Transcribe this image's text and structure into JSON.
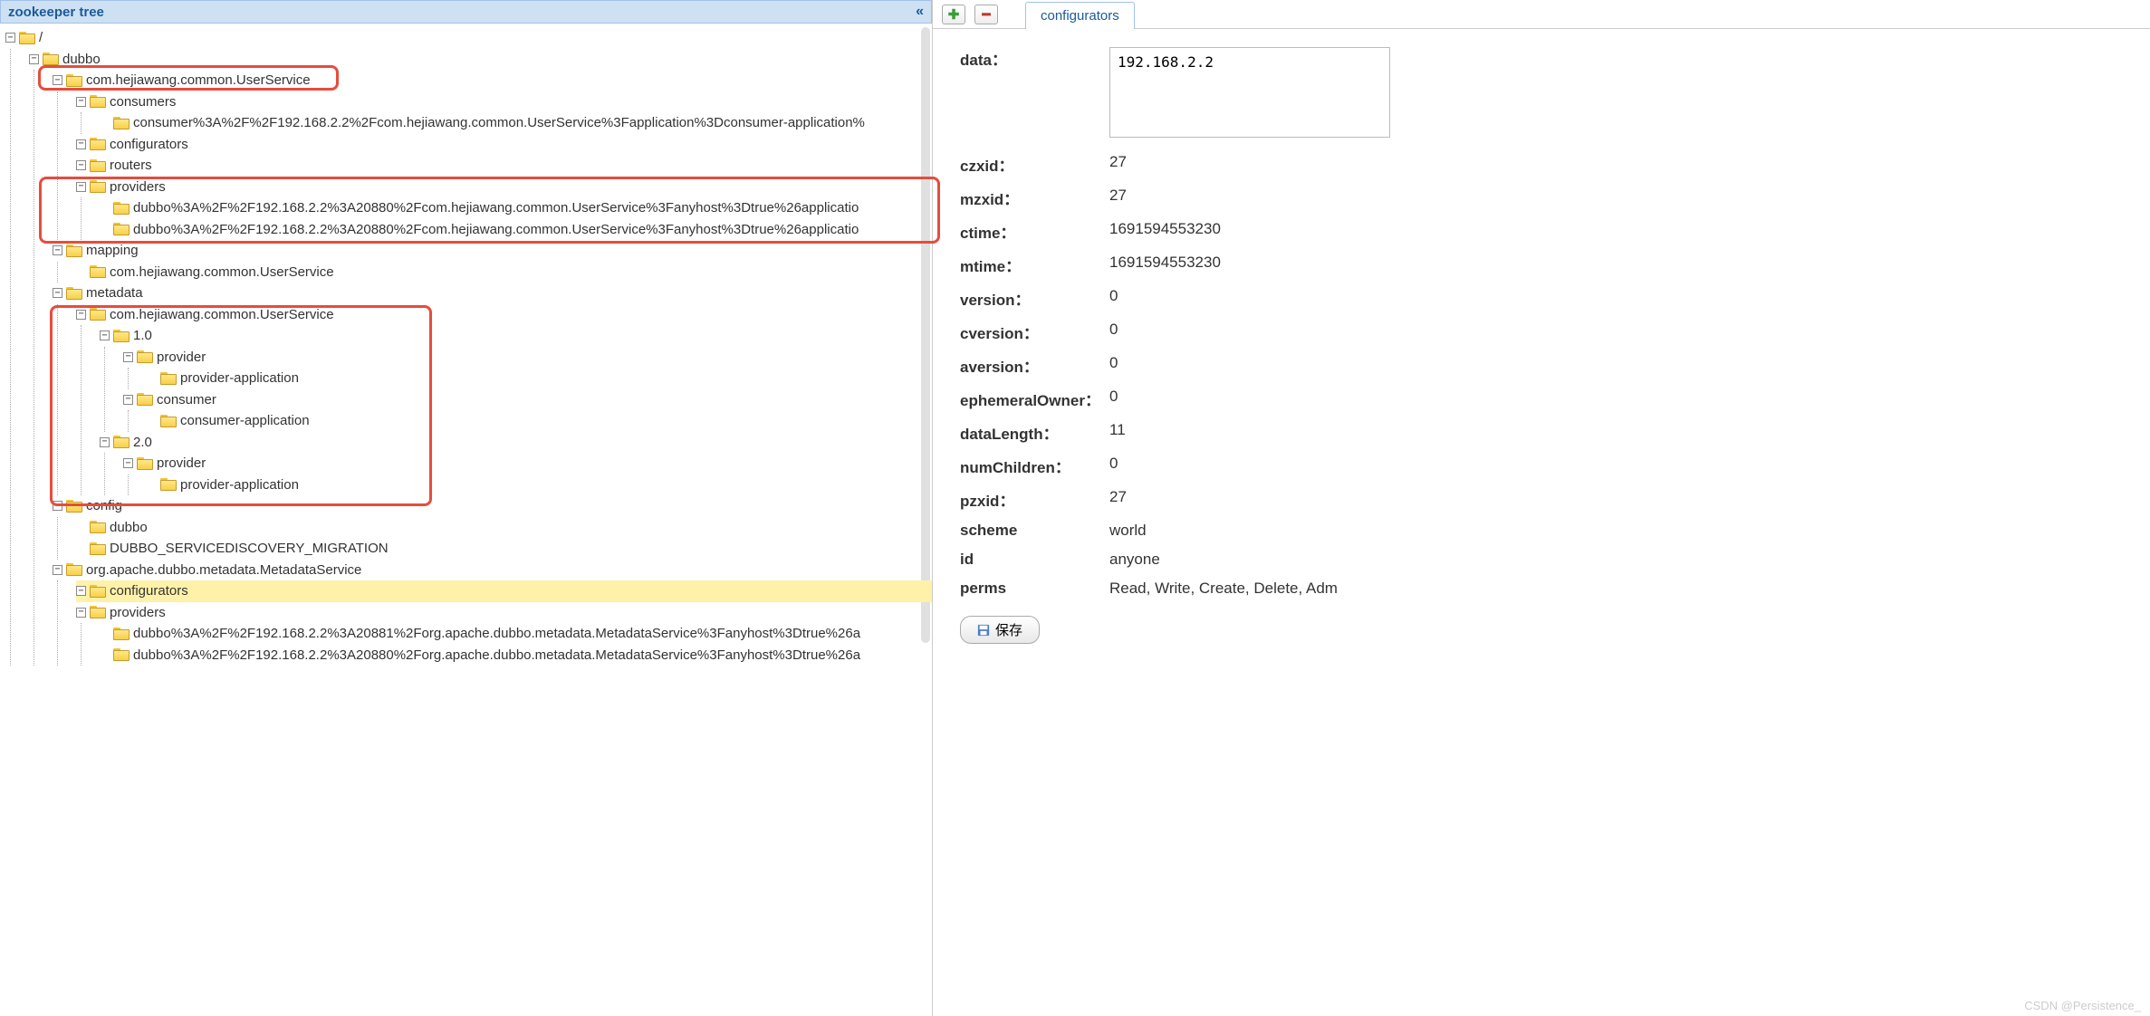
{
  "panel": {
    "title": "zookeeper tree"
  },
  "tab": {
    "label": "configurators"
  },
  "save_label": "保存",
  "watermark": "CSDN @Persistence_",
  "details": {
    "data_value": "192.168.2.2",
    "rows": [
      {
        "label": "data：",
        "value": ""
      },
      {
        "label": "czxid：",
        "value": "27"
      },
      {
        "label": "mzxid：",
        "value": "27"
      },
      {
        "label": "ctime：",
        "value": "1691594553230"
      },
      {
        "label": "mtime：",
        "value": "1691594553230"
      },
      {
        "label": "version：",
        "value": "0"
      },
      {
        "label": "cversion：",
        "value": "0"
      },
      {
        "label": "aversion：",
        "value": "0"
      },
      {
        "label": "ephemeralOwner：",
        "value": "0"
      },
      {
        "label": "dataLength：",
        "value": "11"
      },
      {
        "label": "numChildren：",
        "value": "0"
      },
      {
        "label": "pzxid：",
        "value": "27"
      },
      {
        "label": "scheme",
        "value": "world"
      },
      {
        "label": "id",
        "value": "anyone"
      },
      {
        "label": "perms",
        "value": "Read, Write, Create, Delete, Adm"
      }
    ]
  },
  "tree": {
    "root": "/",
    "nodes": [
      {
        "label": "dubbo",
        "children": [
          {
            "label": "com.hejiawang.common.UserService",
            "children": [
              {
                "label": "consumers",
                "children": [
                  {
                    "label": "consumer%3A%2F%2F192.168.2.2%2Fcom.hejiawang.common.UserService%3Fapplication%3Dconsumer-application%",
                    "leaf": true
                  }
                ]
              },
              {
                "label": "configurators",
                "leaf": false,
                "children": []
              },
              {
                "label": "routers",
                "leaf": false,
                "children": []
              },
              {
                "label": "providers",
                "children": [
                  {
                    "label": "dubbo%3A%2F%2F192.168.2.2%3A20880%2Fcom.hejiawang.common.UserService%3Fanyhost%3Dtrue%26applicatio",
                    "leaf": true
                  },
                  {
                    "label": "dubbo%3A%2F%2F192.168.2.2%3A20880%2Fcom.hejiawang.common.UserService%3Fanyhost%3Dtrue%26applicatio",
                    "leaf": true
                  }
                ]
              }
            ]
          },
          {
            "label": "mapping",
            "children": [
              {
                "label": "com.hejiawang.common.UserService",
                "leaf": true
              }
            ]
          },
          {
            "label": "metadata",
            "children": [
              {
                "label": "com.hejiawang.common.UserService",
                "children": [
                  {
                    "label": "1.0",
                    "children": [
                      {
                        "label": "provider",
                        "children": [
                          {
                            "label": "provider-application",
                            "leaf": true
                          }
                        ]
                      },
                      {
                        "label": "consumer",
                        "children": [
                          {
                            "label": "consumer-application",
                            "leaf": true
                          }
                        ]
                      }
                    ]
                  },
                  {
                    "label": "2.0",
                    "children": [
                      {
                        "label": "provider",
                        "children": [
                          {
                            "label": "provider-application",
                            "leaf": true
                          }
                        ]
                      }
                    ]
                  }
                ]
              }
            ]
          },
          {
            "label": "config",
            "children": [
              {
                "label": "dubbo",
                "leaf": true
              },
              {
                "label": "DUBBO_SERVICEDISCOVERY_MIGRATION",
                "leaf": true
              }
            ]
          },
          {
            "label": "org.apache.dubbo.metadata.MetadataService",
            "children": [
              {
                "label": "configurators",
                "selected": true,
                "leaf": false,
                "children": []
              },
              {
                "label": "providers",
                "children": [
                  {
                    "label": "dubbo%3A%2F%2F192.168.2.2%3A20881%2Forg.apache.dubbo.metadata.MetadataService%3Fanyhost%3Dtrue%26a",
                    "leaf": true
                  },
                  {
                    "label": "dubbo%3A%2F%2F192.168.2.2%3A20880%2Forg.apache.dubbo.metadata.MetadataService%3Fanyhost%3Dtrue%26a",
                    "leaf": true
                  }
                ]
              }
            ]
          }
        ]
      }
    ]
  }
}
